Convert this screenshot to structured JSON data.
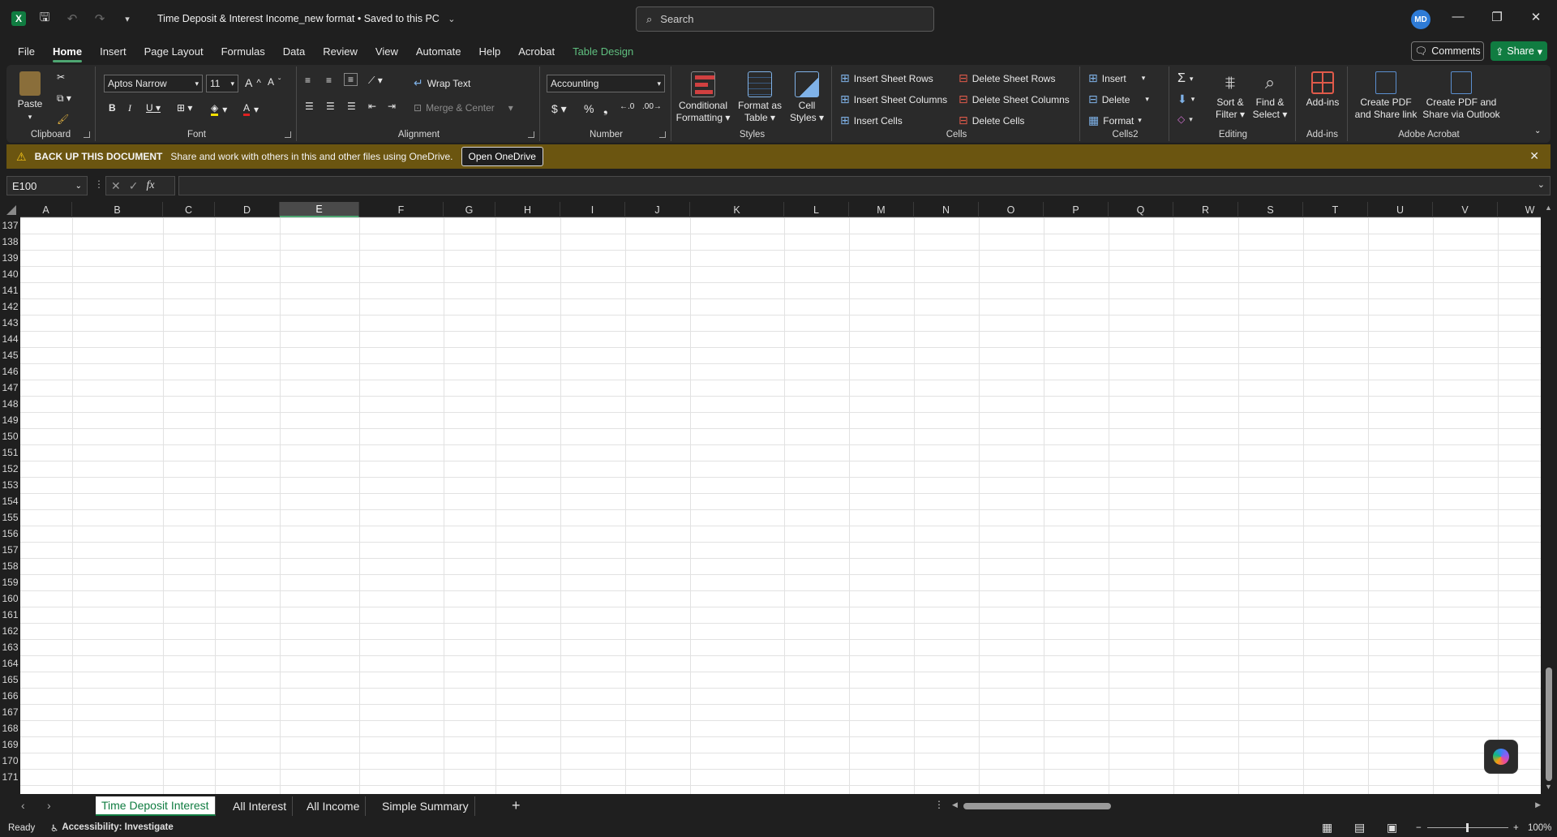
{
  "titlebar": {
    "doc_title": "Time Deposit & Interest Income_new format • Saved to this PC",
    "search_placeholder": "Search",
    "avatar_initials": "MD"
  },
  "menu": {
    "tabs": [
      "File",
      "Home",
      "Insert",
      "Page Layout",
      "Formulas",
      "Data",
      "Review",
      "View",
      "Automate",
      "Help",
      "Acrobat",
      "Table Design"
    ],
    "active": "Home",
    "comments_label": "Comments",
    "share_label": "Share"
  },
  "ribbon": {
    "clipboard": {
      "label": "Clipboard",
      "paste": "Paste"
    },
    "font": {
      "label": "Font",
      "font_name": "Aptos Narrow",
      "font_size": "11"
    },
    "alignment": {
      "label": "Alignment",
      "wrap_text": "Wrap Text",
      "merge_center": "Merge & Center"
    },
    "number": {
      "label": "Number",
      "format": "Accounting"
    },
    "styles": {
      "label": "Styles",
      "conditional": "Conditional Formatting",
      "format_table": "Format as Table",
      "cell_styles": "Cell Styles"
    },
    "cells": {
      "label": "Cells",
      "insert_rows": "Insert Sheet Rows",
      "insert_cols": "Insert Sheet Columns",
      "insert_cells": "Insert Cells",
      "delete_rows": "Delete Sheet Rows",
      "delete_cols": "Delete Sheet Columns",
      "delete_cells": "Delete Cells"
    },
    "cells2": {
      "label": "Cells2",
      "insert": "Insert",
      "delete": "Delete",
      "format": "Format"
    },
    "editing": {
      "label": "Editing",
      "sort_filter": "Sort & Filter",
      "find_select": "Find & Select"
    },
    "addins": {
      "label": "Add-ins",
      "addins_btn": "Add-ins"
    },
    "acrobat": {
      "label": "Adobe Acrobat",
      "create_pdf_link": "Create PDF and Share link",
      "create_pdf_outlook": "Create PDF and Share via Outlook"
    }
  },
  "notification": {
    "title": "BACK UP THIS DOCUMENT",
    "message": "Share and work with others in this and other files using OneDrive.",
    "button": "Open OneDrive"
  },
  "formula_bar": {
    "name_box": "E100",
    "formula": ""
  },
  "grid": {
    "columns": [
      "A",
      "B",
      "C",
      "D",
      "E",
      "F",
      "G",
      "H",
      "I",
      "J",
      "K",
      "L",
      "M",
      "N",
      "O",
      "P",
      "Q",
      "R",
      "S",
      "T",
      "U",
      "V",
      "W"
    ],
    "selected_column": "E",
    "rows": [
      "137",
      "138",
      "139",
      "140",
      "141",
      "142",
      "143",
      "144",
      "145",
      "146",
      "147",
      "148",
      "149",
      "150",
      "151",
      "152",
      "153",
      "154",
      "155",
      "156",
      "157",
      "158",
      "159",
      "160",
      "161",
      "162",
      "163",
      "164",
      "165",
      "166",
      "167",
      "168",
      "169",
      "170",
      "171"
    ]
  },
  "sheets": {
    "tabs": [
      "Time Deposit Interest",
      "All Interest",
      "All Income",
      "Simple Summary"
    ],
    "active": "Time Deposit Interest"
  },
  "status": {
    "ready": "Ready",
    "accessibility": "Accessibility: Investigate",
    "zoom": "100%"
  },
  "colors": {
    "accent": "#107c41",
    "notification_bg": "#6b5510",
    "avatar": "#2e7bd6"
  }
}
